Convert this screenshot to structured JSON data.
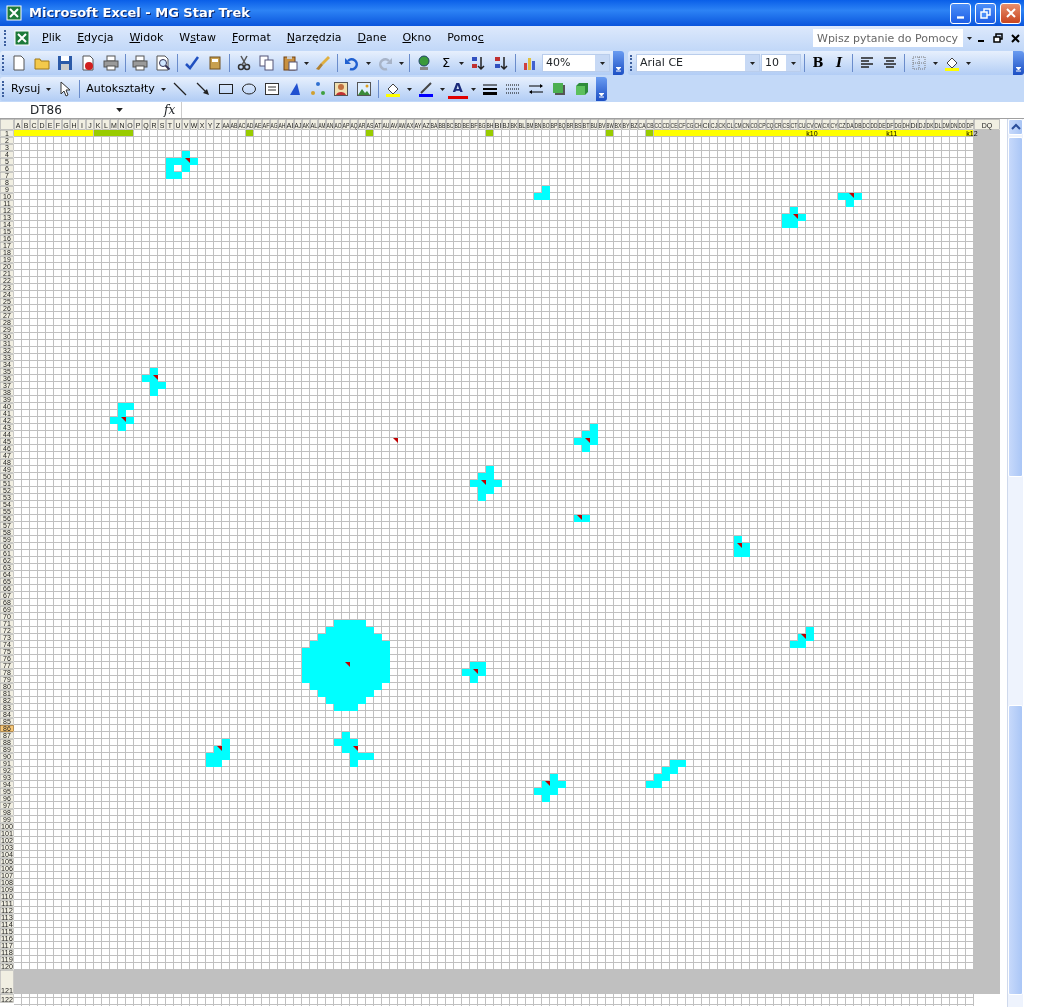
{
  "window": {
    "title": "Microsoft Excel - MG Star Trek"
  },
  "menu": [
    {
      "label": "Plik"
    },
    {
      "label": "Edycja"
    },
    {
      "label": "Widok"
    },
    {
      "label": "Wstaw"
    },
    {
      "label": "Format"
    },
    {
      "label": "Narzędzia"
    },
    {
      "label": "Dane"
    },
    {
      "label": "Okno"
    },
    {
      "label": "Pomoc"
    }
  ],
  "help_box": {
    "placeholder": "Wpisz pytanie do Pomocy"
  },
  "standard_toolbar": {
    "sum": "Σ",
    "zoom": "40%"
  },
  "formatting_toolbar": {
    "font": "Arial CE",
    "size": "10",
    "bold": "B",
    "italic": "I"
  },
  "drawing_toolbar": {
    "draw": "Rysuj",
    "autoshapes": "Autokształty",
    "font_color": "A"
  },
  "formula_bar": {
    "name_box": "DT86",
    "fx": "fx"
  },
  "sheet": {
    "columns": [
      "A",
      "B",
      "C",
      "D",
      "E",
      "F",
      "G",
      "H",
      "I",
      "J",
      "K",
      "L",
      "M",
      "N",
      "O",
      "P",
      "Q",
      "R",
      "S",
      "T",
      "U",
      "V",
      "W",
      "X",
      "Y",
      "Z",
      "AA",
      "AB",
      "AC",
      "AD",
      "AE",
      "AF",
      "AG",
      "AH",
      "AI",
      "AJ",
      "AK",
      "AL",
      "AM",
      "AN",
      "AO",
      "AP",
      "AQ",
      "AR",
      "AS",
      "AT",
      "AU",
      "AV",
      "AW",
      "AX",
      "AY",
      "AZ",
      "BA",
      "BB",
      "BC",
      "BD",
      "BE",
      "BF",
      "BG",
      "BH",
      "BI",
      "BJ",
      "BK",
      "BL",
      "BM",
      "BN",
      "BO",
      "BP",
      "BQ",
      "BR",
      "BS",
      "BT",
      "BU",
      "BV",
      "BW",
      "BX",
      "BY",
      "BZ",
      "CA",
      "CB",
      "CC",
      "CD",
      "CE",
      "CF",
      "CG",
      "CH",
      "CI",
      "CJ",
      "CK",
      "CL",
      "CM",
      "CN",
      "CO",
      "CP",
      "CQ",
      "CR",
      "CS",
      "CT",
      "CU",
      "CV",
      "CW",
      "CX",
      "CY",
      "CZ",
      "DA",
      "DB",
      "DC",
      "DD",
      "DE",
      "DF",
      "DG",
      "DH",
      "DI",
      "DJ",
      "DK",
      "DL",
      "DM",
      "DN",
      "DO",
      "DP",
      "DQ"
    ],
    "rows": [
      {
        "label": "1",
        "selected": false
      },
      {
        "label": "2",
        "selected": false
      },
      {
        "label": "3",
        "selected": false
      },
      {
        "label": "4",
        "selected": false
      },
      {
        "label": "5",
        "selected": false
      },
      {
        "label": "6",
        "selected": false
      },
      {
        "label": "7",
        "selected": false
      },
      {
        "label": "8",
        "selected": false
      },
      {
        "label": "9",
        "selected": false
      },
      {
        "label": "10",
        "selected": false
      },
      {
        "label": "11",
        "selected": false
      },
      {
        "label": "12",
        "selected": false
      },
      {
        "label": "13",
        "selected": false
      },
      {
        "label": "14",
        "selected": false
      },
      {
        "label": "15",
        "selected": false
      },
      {
        "label": "16",
        "selected": false
      },
      {
        "label": "17",
        "selected": false
      },
      {
        "label": "18",
        "selected": false
      },
      {
        "label": "19",
        "selected": false
      },
      {
        "label": "20",
        "selected": false
      },
      {
        "label": "21",
        "selected": false
      },
      {
        "label": "22",
        "selected": false
      },
      {
        "label": "23",
        "selected": false
      },
      {
        "label": "24",
        "selected": false
      },
      {
        "label": "25",
        "selected": false
      },
      {
        "label": "26",
        "selected": false
      },
      {
        "label": "27",
        "selected": false
      },
      {
        "label": "28",
        "selected": false
      },
      {
        "label": "29",
        "selected": false
      },
      {
        "label": "30",
        "selected": false
      },
      {
        "label": "31",
        "selected": false
      },
      {
        "label": "32",
        "selected": false
      },
      {
        "label": "33",
        "selected": false
      },
      {
        "label": "34",
        "selected": false
      },
      {
        "label": "35",
        "selected": false
      },
      {
        "label": "36",
        "selected": false
      },
      {
        "label": "37",
        "selected": false
      },
      {
        "label": "38",
        "selected": false
      },
      {
        "label": "39",
        "selected": false
      },
      {
        "label": "40",
        "selected": false
      },
      {
        "label": "41",
        "selected": false
      },
      {
        "label": "42",
        "selected": false
      },
      {
        "label": "43",
        "selected": false
      },
      {
        "label": "44",
        "selected": false
      },
      {
        "label": "45",
        "selected": false
      },
      {
        "label": "46",
        "selected": false
      },
      {
        "label": "47",
        "selected": false
      },
      {
        "label": "48",
        "selected": false
      },
      {
        "label": "49",
        "selected": false
      },
      {
        "label": "50",
        "selected": false
      },
      {
        "label": "51",
        "selected": false
      },
      {
        "label": "52",
        "selected": false
      },
      {
        "label": "53",
        "selected": false
      },
      {
        "label": "54",
        "selected": false
      },
      {
        "label": "55",
        "selected": false
      },
      {
        "label": "56",
        "selected": false
      },
      {
        "label": "57",
        "selected": false
      },
      {
        "label": "58",
        "selected": false
      },
      {
        "label": "59",
        "selected": false
      },
      {
        "label": "60",
        "selected": false
      },
      {
        "label": "61",
        "selected": false
      },
      {
        "label": "62",
        "selected": false
      },
      {
        "label": "63",
        "selected": false
      },
      {
        "label": "64",
        "selected": false
      },
      {
        "label": "65",
        "selected": false
      },
      {
        "label": "66",
        "selected": false
      },
      {
        "label": "67",
        "selected": false
      },
      {
        "label": "68",
        "selected": false
      },
      {
        "label": "69",
        "selected": false
      },
      {
        "label": "70",
        "selected": false
      },
      {
        "label": "71",
        "selected": false
      },
      {
        "label": "72",
        "selected": false
      },
      {
        "label": "73",
        "selected": false
      },
      {
        "label": "74",
        "selected": false
      },
      {
        "label": "75",
        "selected": false
      },
      {
        "label": "76",
        "selected": false
      },
      {
        "label": "77",
        "selected": false
      },
      {
        "label": "78",
        "selected": false
      },
      {
        "label": "79",
        "selected": false
      },
      {
        "label": "80",
        "selected": false
      },
      {
        "label": "81",
        "selected": false
      },
      {
        "label": "82",
        "selected": false
      },
      {
        "label": "83",
        "selected": false
      },
      {
        "label": "84",
        "selected": false
      },
      {
        "label": "85",
        "selected": false
      },
      {
        "label": "86",
        "selected": true
      },
      {
        "label": "87",
        "selected": false
      },
      {
        "label": "88",
        "selected": false
      },
      {
        "label": "89",
        "selected": false
      },
      {
        "label": "90",
        "selected": false
      },
      {
        "label": "91",
        "selected": false
      },
      {
        "label": "92",
        "selected": false
      },
      {
        "label": "93",
        "selected": false
      },
      {
        "label": "94",
        "selected": false
      },
      {
        "label": "95",
        "selected": false
      },
      {
        "label": "96",
        "selected": false
      },
      {
        "label": "97",
        "selected": false
      },
      {
        "label": "98",
        "selected": false
      },
      {
        "label": "99",
        "selected": false
      },
      {
        "label": "100",
        "selected": false
      },
      {
        "label": "101",
        "selected": false
      },
      {
        "label": "102",
        "selected": false
      },
      {
        "label": "103",
        "selected": false
      },
      {
        "label": "104",
        "selected": false
      },
      {
        "label": "105",
        "selected": false
      },
      {
        "label": "106",
        "selected": false
      },
      {
        "label": "107",
        "selected": false
      },
      {
        "label": "108",
        "selected": false
      },
      {
        "label": "109",
        "selected": false
      },
      {
        "label": "110",
        "selected": false
      },
      {
        "label": "111",
        "selected": false
      },
      {
        "label": "112",
        "selected": false
      },
      {
        "label": "113",
        "selected": false
      },
      {
        "label": "114",
        "selected": false
      },
      {
        "label": "115",
        "selected": false
      },
      {
        "label": "116",
        "selected": false
      },
      {
        "label": "117",
        "selected": false
      },
      {
        "label": "118",
        "selected": false
      },
      {
        "label": "119",
        "selected": false
      },
      {
        "label": "120",
        "selected": false
      },
      {
        "label": "121",
        "selected": false
      },
      {
        "label": "122",
        "selected": false
      }
    ],
    "row1_cells": [
      {
        "color": "#ffff00"
      },
      {
        "color": "#99cc00"
      },
      {
        "color": "#99cc00"
      },
      {
        "color": "#99cc00"
      },
      {
        "color": "#99cc00"
      },
      {
        "color": "#99cc00"
      },
      {
        "color": "#99cc00"
      },
      {
        "color": "#ffff00"
      },
      {
        "text": "k10"
      },
      {
        "text": "k11"
      },
      {
        "text": "k12"
      }
    ]
  }
}
